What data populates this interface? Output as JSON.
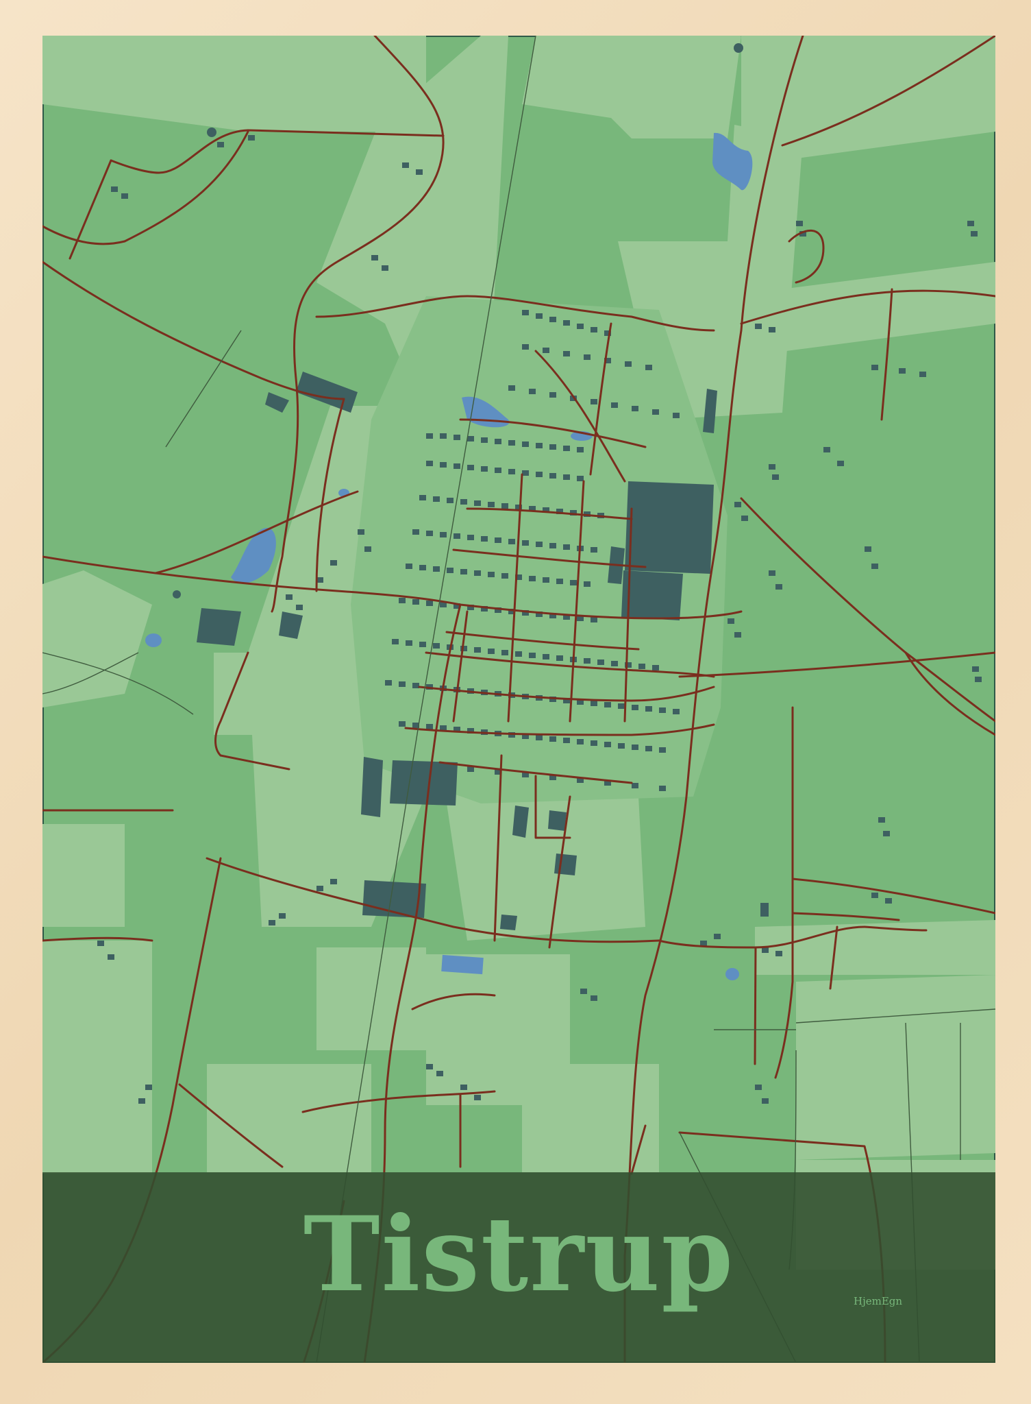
{
  "poster": {
    "town_name": "Tistrup",
    "brand": "HjemEgn"
  },
  "colors": {
    "frame": "#f3dfc0",
    "field": "#78b77b",
    "field_light": "#9ac896",
    "road": "#7a2e1e",
    "building": "#3e6061",
    "water": "#5f8fc2",
    "band": "#324e30",
    "title": "#78b77b"
  }
}
